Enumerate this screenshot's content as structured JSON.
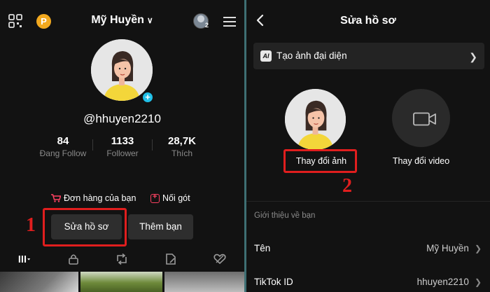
{
  "left": {
    "username": "Mỹ Huyền",
    "coin_label": "P",
    "friends_badge": "2",
    "handle": "@hhuyen2210",
    "stats": [
      {
        "value": "84",
        "label": "Đang Follow"
      },
      {
        "value": "1133",
        "label": "Follower"
      },
      {
        "value": "28,7K",
        "label": "Thích"
      }
    ],
    "shop_orders": "Đơn hàng của bạn",
    "shop_pin": "Nối gót",
    "edit_profile": "Sửa hồ sơ",
    "add_friend": "Thêm bạn",
    "step_number": "1",
    "tabs": [
      "grid-icon",
      "lock-icon",
      "repost-icon",
      "favorites-icon",
      "liked-icon"
    ]
  },
  "right": {
    "title": "Sửa hồ sơ",
    "ai_badge": "AI",
    "ai_label": "Tạo ảnh đại diện",
    "change_photo": "Thay đổi ảnh",
    "change_video": "Thay đổi video",
    "step_number": "2",
    "section_label": "Giới thiệu về bạn",
    "rows": [
      {
        "label": "Tên",
        "value": "Mỹ Huyền"
      },
      {
        "label": "TikTok ID",
        "value": "hhuyen2210"
      }
    ]
  },
  "colors": {
    "background": "#121212",
    "highlight_red": "#e01e1e",
    "divider_teal": "#3e6f73",
    "plus_blue": "#21c0e8",
    "coin_orange": "#f2a91f"
  }
}
